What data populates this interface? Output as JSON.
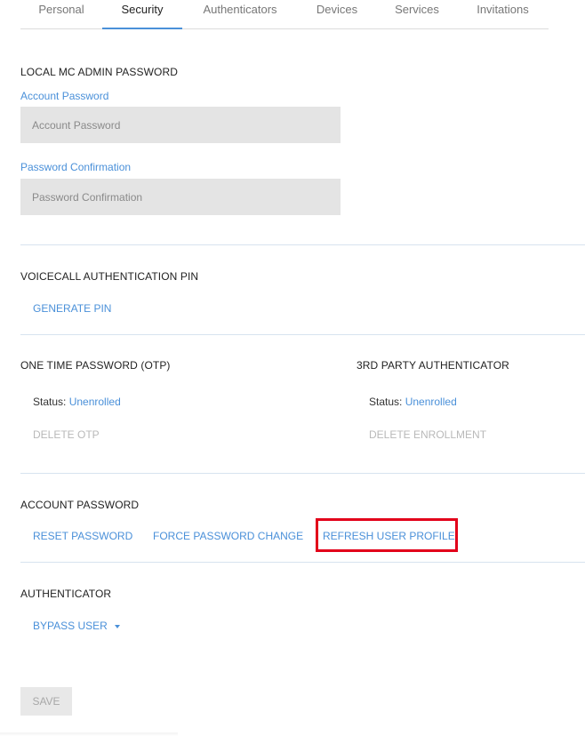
{
  "tabs": [
    {
      "label": "Personal",
      "active": false
    },
    {
      "label": "Security",
      "active": true
    },
    {
      "label": "Authenticators",
      "active": false
    },
    {
      "label": "Devices",
      "active": false
    },
    {
      "label": "Services",
      "active": false
    },
    {
      "label": "Invitations",
      "active": false
    }
  ],
  "local_admin": {
    "title": "LOCAL MC ADMIN PASSWORD",
    "account_password_label": "Account Password",
    "account_password_placeholder": "Account Password",
    "account_password_value": "",
    "confirmation_label": "Password Confirmation",
    "confirmation_placeholder": "Password Confirmation",
    "confirmation_value": ""
  },
  "voicecall": {
    "title": "VOICECALL AUTHENTICATION PIN",
    "generate_pin_label": "GENERATE PIN"
  },
  "otp": {
    "title": "ONE TIME PASSWORD (OTP)",
    "status_label": "Status:",
    "status_value": "Unenrolled",
    "delete_label": "DELETE OTP"
  },
  "third_party": {
    "title": "3RD PARTY AUTHENTICATOR",
    "status_label": "Status:",
    "status_value": "Unenrolled",
    "delete_label": "DELETE ENROLLMENT"
  },
  "account_password": {
    "title": "ACCOUNT PASSWORD",
    "reset_label": "RESET PASSWORD",
    "force_change_label": "FORCE PASSWORD CHANGE",
    "refresh_profile_label": "REFRESH USER PROFILE"
  },
  "authenticator": {
    "title": "AUTHENTICATOR",
    "bypass_label": "BYPASS USER"
  },
  "save_label": "SAVE",
  "colors": {
    "accent": "#4a90d9",
    "highlight": "#e2001a",
    "input_bg": "#e4e4e4"
  }
}
